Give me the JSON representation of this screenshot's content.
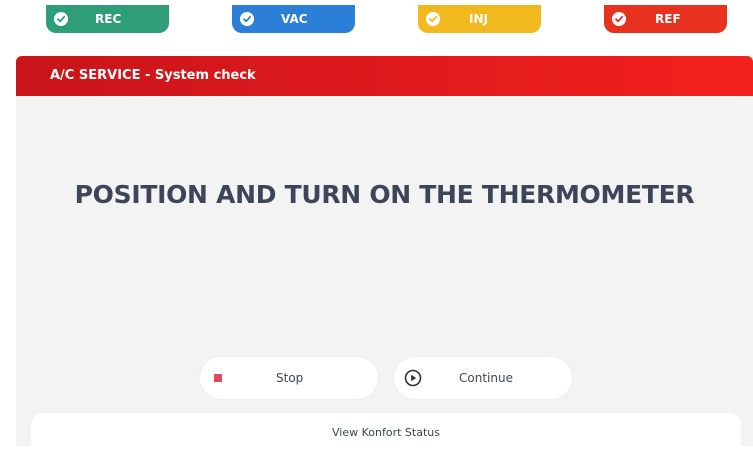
{
  "status_tabs": [
    {
      "label": "REC",
      "color": "#2f9d78"
    },
    {
      "label": "VAC",
      "color": "#2c7fd6"
    },
    {
      "label": "INJ",
      "color": "#f2b91e"
    },
    {
      "label": "REF",
      "color": "#e8311e"
    }
  ],
  "panel": {
    "title": "A/C SERVICE - System check",
    "instruction": "POSITION AND TURN ON THE THERMOMETER"
  },
  "buttons": {
    "stop_label": "Stop",
    "continue_label": "Continue"
  },
  "status_bar": {
    "label": "View Konfort Status"
  },
  "icons": {
    "check": "check-icon",
    "stop": "stop-icon",
    "play": "play-circle-icon"
  },
  "colors": {
    "header_red": "#e11a1d",
    "stop_red": "#e04b5f",
    "text_dark": "#3d4559"
  }
}
